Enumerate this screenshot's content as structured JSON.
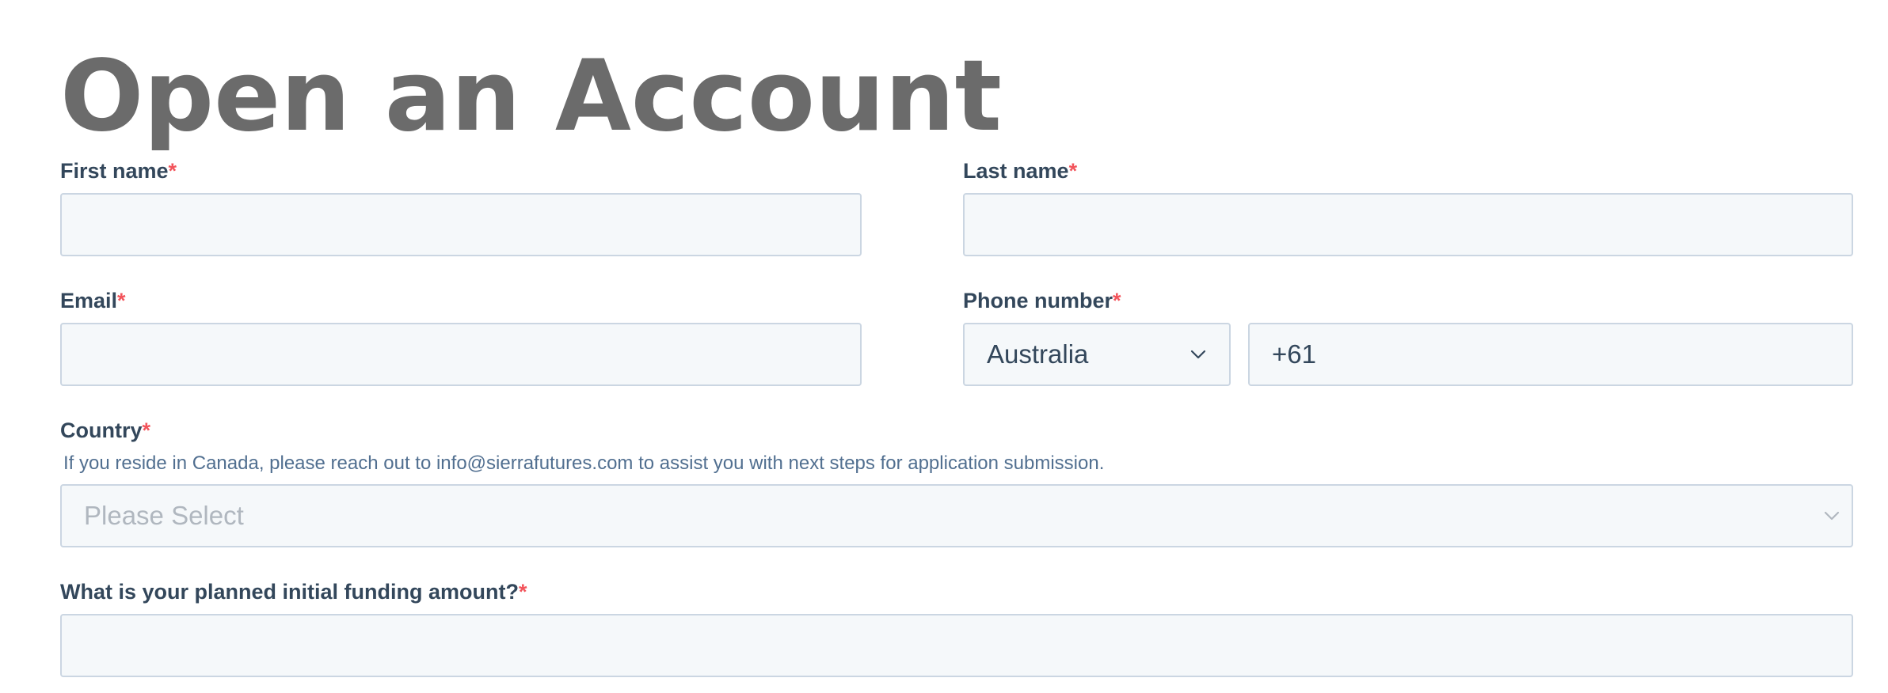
{
  "page": {
    "title": "Open an Account"
  },
  "form": {
    "required_marker": "*",
    "first_name": {
      "label": "First name",
      "value": ""
    },
    "last_name": {
      "label": "Last name",
      "value": ""
    },
    "email": {
      "label": "Email",
      "value": ""
    },
    "phone": {
      "label": "Phone number",
      "country_code_select": "Australia",
      "value": "+61"
    },
    "country": {
      "label": "Country",
      "hint": "If you reside in Canada, please reach out to info@sierrafutures.com to assist you with next steps for application submission.",
      "placeholder": "Please Select"
    },
    "funding": {
      "label": "What is your planned initial funding amount?",
      "value": ""
    }
  },
  "icons": {
    "select_chevron": "chevron-down-icon"
  },
  "colors": {
    "title": "#6b6b6b",
    "label": "#33475b",
    "required": "#f2545b",
    "hint": "#516f90",
    "input_bg": "#f5f8fa",
    "input_border": "#cbd6e2",
    "placeholder": "#b0b7bf"
  }
}
